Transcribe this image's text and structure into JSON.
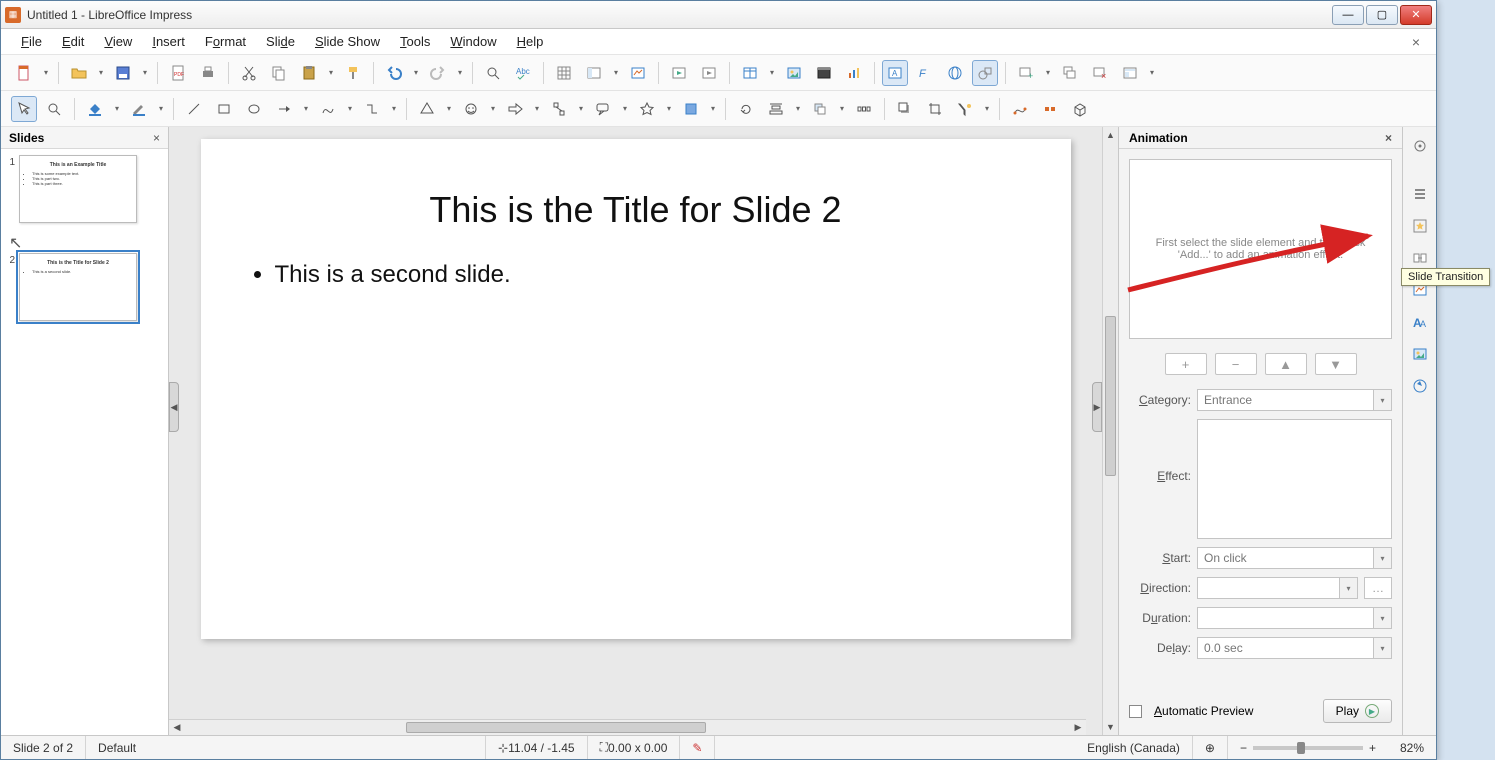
{
  "window": {
    "title": "Untitled 1 - LibreOffice Impress"
  },
  "menu": [
    "File",
    "Edit",
    "View",
    "Insert",
    "Format",
    "Slide",
    "Slide Show",
    "Tools",
    "Window",
    "Help"
  ],
  "slides_panel": {
    "title": "Slides"
  },
  "slides": [
    {
      "num": "1",
      "title": "This is an Example Title",
      "bullets": [
        "This is some example text.",
        "This is part two.",
        "This is part three."
      ]
    },
    {
      "num": "2",
      "title": "This is the Title for Slide 2",
      "bullets": [
        "This is a second slide."
      ]
    }
  ],
  "current_slide": {
    "title": "This is the Title for Slide 2",
    "bullet1": "This is a second slide."
  },
  "animation": {
    "panel_title": "Animation",
    "hint": "First select the slide element and then click 'Add...' to add an animation effect.",
    "category_label": "Category:",
    "category_value": "Entrance",
    "effect_label": "Effect:",
    "start_label": "Start:",
    "start_value": "On click",
    "direction_label": "Direction:",
    "duration_label": "Duration:",
    "delay_label": "Delay:",
    "delay_value": "0.0 sec",
    "auto_preview": "Automatic Preview",
    "play": "Play"
  },
  "tooltip": {
    "slide_transition": "Slide Transition"
  },
  "status": {
    "slide_pos": "Slide 2 of 2",
    "master": "Default",
    "cursor": "11.04 / -1.45",
    "size": "0.00 x 0.00",
    "lang": "English (Canada)",
    "zoom": "82%"
  }
}
